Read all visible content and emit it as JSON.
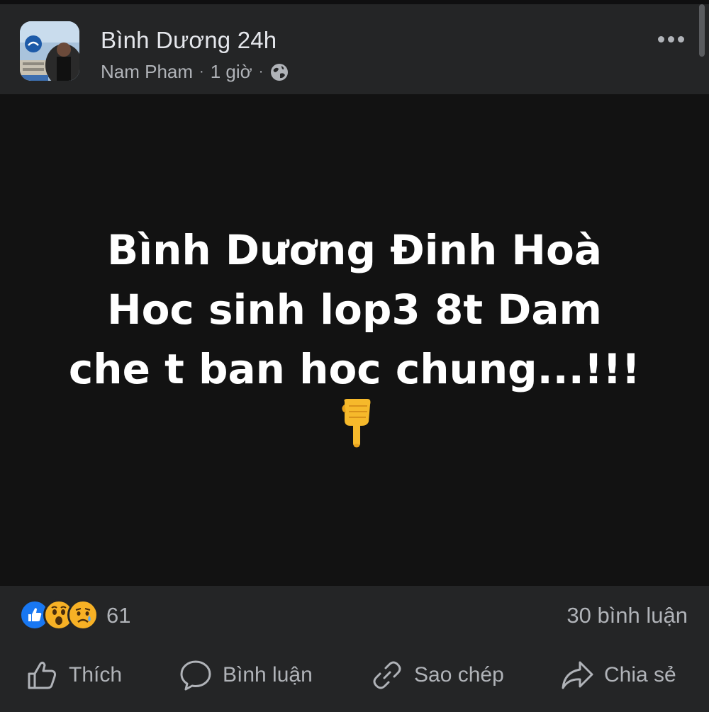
{
  "header": {
    "page_name": "Bình Dương 24h",
    "author": "Nam Pham",
    "separator": "·",
    "time": "1 giờ",
    "privacy_icon": "globe-icon",
    "more_icon": "more-options-icon"
  },
  "post": {
    "lines": [
      "Bình Dương Đinh Hoà",
      "Hoc sinh lop3 8t Dam",
      "che t ban hoc chung...!!!"
    ],
    "emoji": "pointing-down-emoji"
  },
  "stats": {
    "reaction_icons": [
      "like-reaction-icon",
      "wow-reaction-icon",
      "sad-reaction-icon"
    ],
    "reaction_count": "61",
    "comment_count": "30 bình luận"
  },
  "actions": {
    "like": "Thích",
    "comment": "Bình luận",
    "copy": "Sao chép",
    "share": "Chia sẻ"
  },
  "colors": {
    "background": "#242526",
    "content_bg": "#121212",
    "text_primary": "#e4e6eb",
    "text_secondary": "#b0b3b8",
    "like_blue": "#1877f2",
    "reaction_yellow": "#f7b125"
  }
}
